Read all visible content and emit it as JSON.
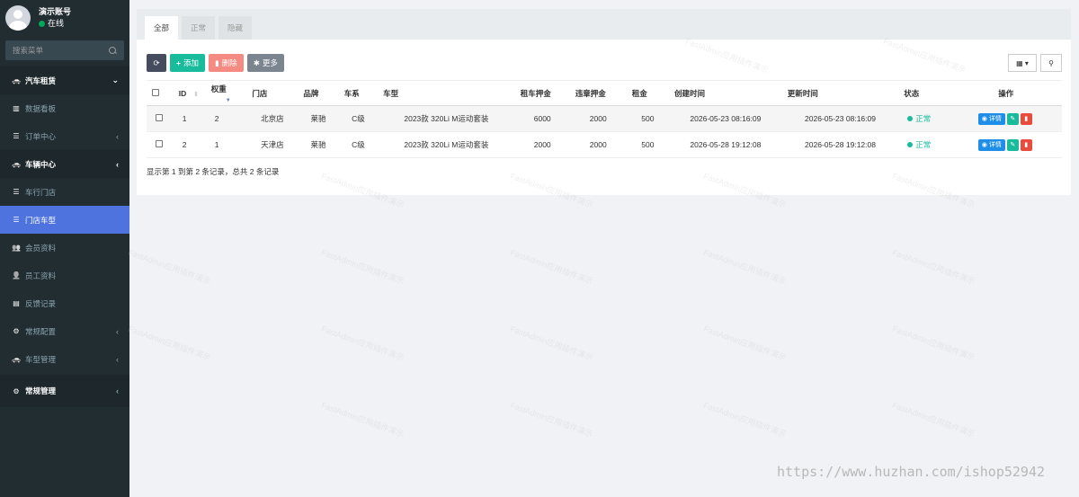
{
  "user": {
    "name": "演示账号",
    "status": "在线"
  },
  "search": {
    "placeholder": "搜索菜单"
  },
  "menu": [
    {
      "label": "汽车租赁",
      "icon": "car-icon",
      "type": "header",
      "arrow": "⌄"
    },
    {
      "label": "数据看板",
      "icon": "chart-icon",
      "type": "item",
      "arrow": ""
    },
    {
      "label": "订单中心",
      "icon": "list-icon",
      "type": "item",
      "arrow": "‹"
    },
    {
      "label": "车辆中心",
      "icon": "car-icon",
      "type": "header",
      "arrow": "‹"
    },
    {
      "label": "车行门店",
      "icon": "list-icon",
      "type": "item",
      "arrow": ""
    },
    {
      "label": "门店车型",
      "icon": "list-icon",
      "type": "active",
      "arrow": ""
    },
    {
      "label": "会员资料",
      "icon": "users-icon",
      "type": "item",
      "arrow": ""
    },
    {
      "label": "员工资料",
      "icon": "user-icon",
      "type": "item",
      "arrow": ""
    },
    {
      "label": "反馈记录",
      "icon": "book-icon",
      "type": "item",
      "arrow": ""
    },
    {
      "label": "常规配置",
      "icon": "gear-icon",
      "type": "item",
      "arrow": "‹"
    },
    {
      "label": "车型管理",
      "icon": "car-icon",
      "type": "item",
      "arrow": "‹"
    },
    {
      "label": "常规管理",
      "icon": "cogs-icon",
      "type": "bottom-header",
      "arrow": "‹"
    }
  ],
  "tabs": [
    "全部",
    "正常",
    "隐藏"
  ],
  "toolbar": {
    "add": "添加",
    "delete": "删除",
    "more": "更多"
  },
  "columns": [
    "ID",
    "权重",
    "门店",
    "品牌",
    "车系",
    "车型",
    "租车押金",
    "违章押金",
    "租金",
    "创建时间",
    "更新时间",
    "状态",
    "操作"
  ],
  "rows": [
    {
      "id": "1",
      "weight": "2",
      "store": "北京店",
      "brand": "莱驰",
      "series": "C级",
      "model": "2023款 320Li M运动套装",
      "deposit": "6000",
      "violation": "2000",
      "rent": "500",
      "created": "2026-05-23 08:16:09",
      "updated": "2026-05-23 08:16:09",
      "status": "正常"
    },
    {
      "id": "2",
      "weight": "1",
      "store": "天津店",
      "brand": "莱驰",
      "series": "C级",
      "model": "2023款 320Li M运动套装",
      "deposit": "2000",
      "violation": "2000",
      "rent": "500",
      "created": "2026-05-28 19:12:08",
      "updated": "2026-05-28 19:12:08",
      "status": "正常"
    }
  ],
  "row_action": "详情",
  "pagination_text": "显示第 1 到第 2 条记录，总共 2 条记录",
  "watermark": "FastAdmin应用插件演示",
  "site_url": "https://www.huzhan.com/ishop52942",
  "colors": {
    "sidebar": "#222d32",
    "active": "#4e73df",
    "success": "#18bc9c",
    "danger": "#e74c3c"
  }
}
